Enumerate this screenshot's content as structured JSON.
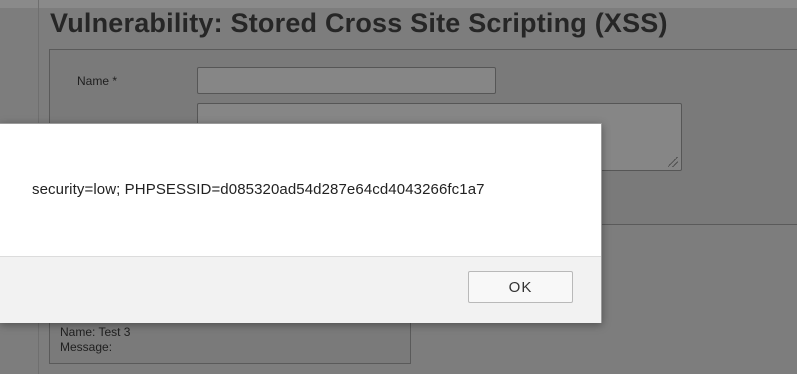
{
  "page": {
    "heading": "Vulnerability: Stored Cross Site Scripting (XSS)",
    "form": {
      "name_label": "Name *",
      "name_value": "",
      "message_value": ""
    },
    "entry": {
      "name_line": "Name: Test 3",
      "message_line": "Message:"
    }
  },
  "dialog": {
    "message": "security=low; PHPSESSID=d085320ad54d287e64cd4043266fc1a7",
    "ok_label": "OK"
  },
  "colors": {
    "overlay_background": "#7d7d7d",
    "dialog_background": "#ffffff",
    "dialog_footer": "#f2f2f2"
  }
}
